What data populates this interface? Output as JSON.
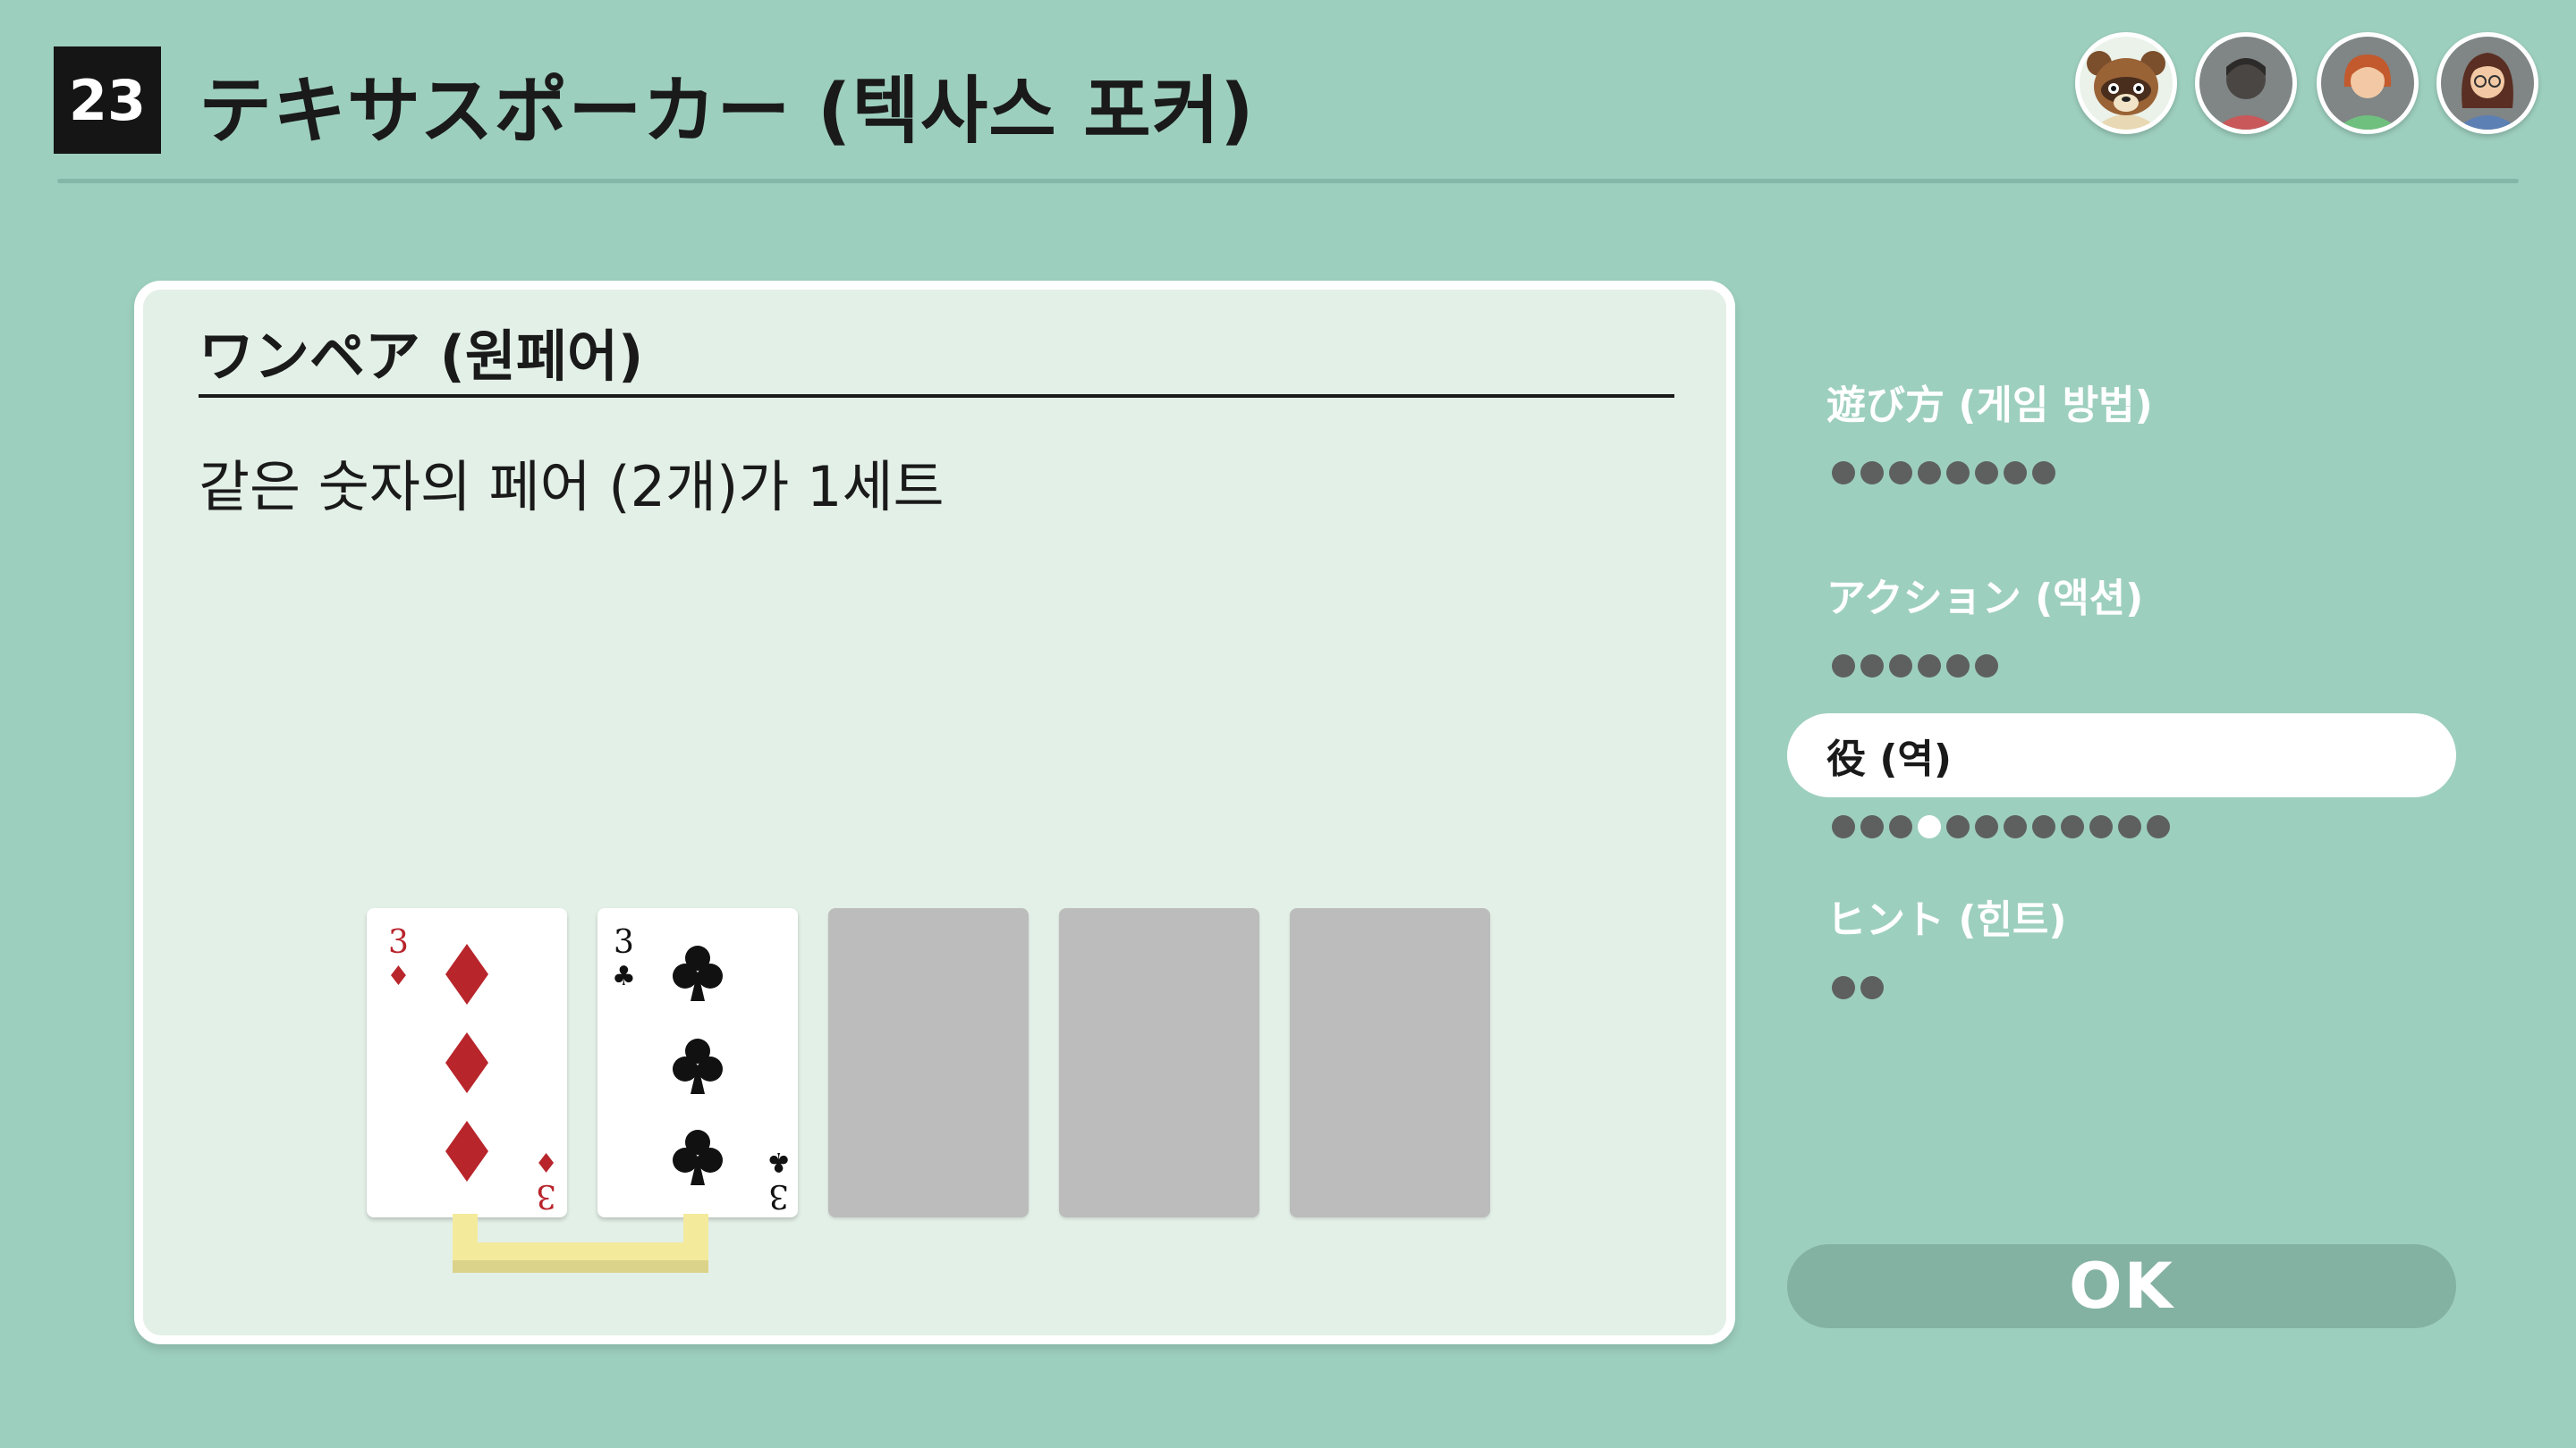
{
  "header": {
    "game_number": "23",
    "title": "テキサスポーカー (텍사스 포커)"
  },
  "players": [
    {
      "name": "raccoon-avatar"
    },
    {
      "name": "player-avatar-gray"
    },
    {
      "name": "player-avatar-redhair"
    },
    {
      "name": "player-avatar-glasses"
    }
  ],
  "panel": {
    "heading": "ワンペア (원페어)",
    "description": "같은 숫자의 페어 (2개)가 1세트",
    "cards": [
      {
        "rank": "3",
        "suit": "diamonds",
        "suit_symbol": "♦",
        "color": "#b8252b"
      },
      {
        "rank": "3",
        "suit": "clubs",
        "suit_symbol": "♣",
        "color": "#111111"
      }
    ],
    "empty_slots": 3
  },
  "menu": {
    "items": [
      {
        "label": "遊び方 (게임 방법)",
        "active": false,
        "pages": 8,
        "current_page": null
      },
      {
        "label": "アクション (액션)",
        "active": false,
        "pages": 6,
        "current_page": null
      },
      {
        "label": "役 (역)",
        "active": true,
        "pages": 12,
        "current_page": 4
      },
      {
        "label": "ヒント (힌트)",
        "active": false,
        "pages": 2,
        "current_page": null
      }
    ]
  },
  "ok_button": {
    "label": "OK"
  },
  "colors": {
    "background": "#9dcfbe",
    "panel": "#e3f0e7",
    "highlight": "#f4ea9c",
    "diamond_red": "#b8252b",
    "club_black": "#111111",
    "ok_button": "#84b2a2"
  }
}
